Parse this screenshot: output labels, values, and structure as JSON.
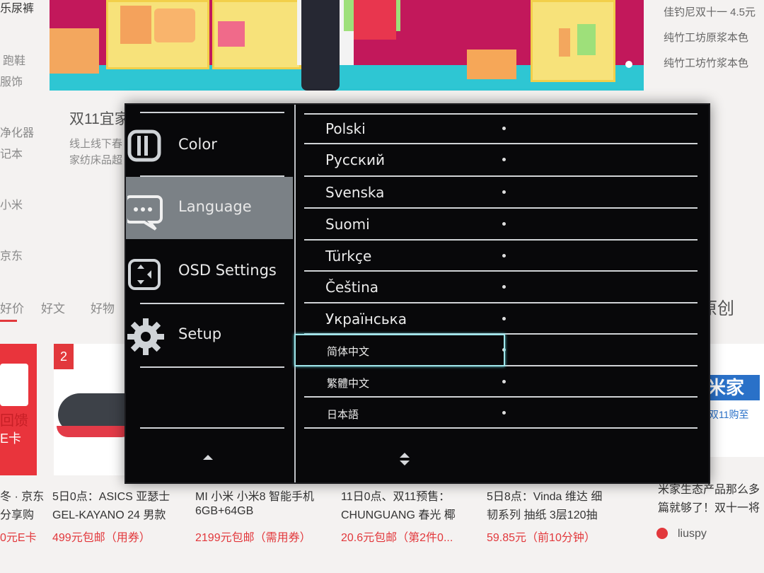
{
  "background": {
    "banner_color": "#c2185b",
    "left_items": [
      "乐尿裤",
      "跑鞋",
      "服饰",
      "净化器",
      "记本",
      "小米",
      "京东"
    ],
    "article": {
      "title": "双11宜家",
      "desc_line1": "线上线下春",
      "desc_line2": "家纺床品超"
    },
    "right_top": [
      "佳钓尼双十一 4.5元",
      "纯竹工坊原浆本色",
      "纯竹工坊竹浆本色"
    ],
    "tabs": [
      "好价",
      "好文",
      "好物"
    ],
    "right_heading": "原创",
    "products": [
      {
        "line1": "冬 · 京东",
        "line2": "分享购",
        "price": "0元E卡"
      },
      {
        "rank": "2",
        "line1": "5日0点：ASICS 亚瑟士",
        "line2": "GEL-KAYANO 24 男款",
        "price": "499元包邮（用券）"
      },
      {
        "line1": "MI 小米 小米8 智能手机",
        "line2": "6GB+64GB",
        "price": "2199元包邮（需用券）"
      },
      {
        "line1": "11日0点、双11预售：",
        "line2": "CHUNGUANG 春光 椰",
        "price": "20.6元包邮（第2件0..."
      },
      {
        "line1": "5日8点：Vinda 维达 细",
        "line2": "韧系列 抽纸 3层120抽",
        "price": "59.85元（前10分钟）"
      }
    ],
    "right_card": {
      "badge_text": "米家",
      "badge_sub": "双11购至",
      "desc_line1": "米家生态产品那么多",
      "desc_line2": "篇就够了！双十一将",
      "author": "liuspy"
    },
    "left_card": {
      "text1": "回馈",
      "text2": "E卡"
    }
  },
  "osd": {
    "menu": [
      {
        "label": "Color",
        "icon": "color-icon"
      },
      {
        "label": "Language",
        "icon": "speech-bubble-icon",
        "active": true
      },
      {
        "label": "OSD Settings",
        "icon": "osd-settings-icon"
      },
      {
        "label": "Setup",
        "icon": "gear-icon"
      }
    ],
    "languages": [
      "Polski",
      "Русский",
      "Svenska",
      "Suomi",
      "Türkçe",
      "Čeština",
      "Українська",
      "简体中文",
      "繁體中文",
      "日本語"
    ],
    "selected_language": "简体中文",
    "nav_up_icon": "arrow-up-icon",
    "nav_updown_icon": "arrow-up-down-icon",
    "selection_color": "#9fe5ea"
  }
}
